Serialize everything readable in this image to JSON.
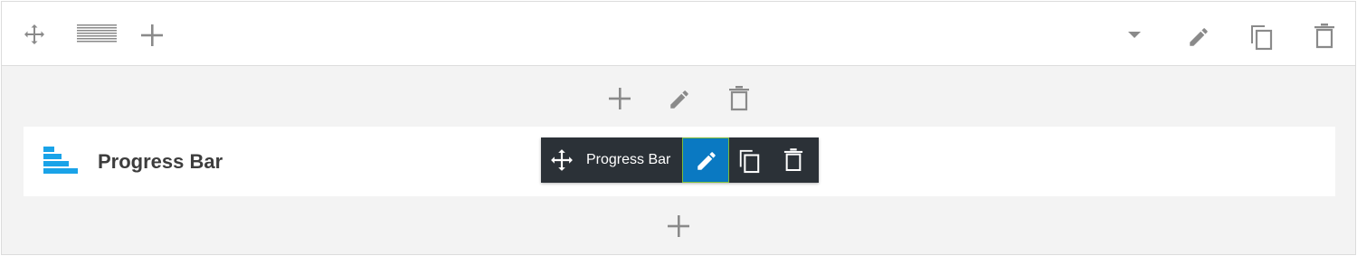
{
  "section_toolbar": {
    "icons": [
      "move-icon",
      "column-layout-icon",
      "add-icon",
      "dropdown-arrow-icon",
      "edit-icon",
      "duplicate-icon",
      "delete-icon"
    ]
  },
  "column_controls": {
    "icons": [
      "add-icon",
      "edit-icon",
      "delete-icon"
    ]
  },
  "widget": {
    "title": "Progress Bar",
    "icon": "progress-bar-icon",
    "accent_color": "#1aa3e8"
  },
  "widget_toolbar": {
    "label": "Progress Bar",
    "icons": [
      "move-icon",
      "edit-icon",
      "duplicate-icon",
      "delete-icon"
    ],
    "background_color": "#2b3137",
    "edit_active_color": "#0a79c2",
    "edit_outline_color": "#7cbc3b"
  },
  "footer": {
    "icons": [
      "add-icon"
    ]
  },
  "colors": {
    "icon_gray": "#8a8a8a",
    "section_bg": "#f3f3f3",
    "border": "#dcdcdc"
  }
}
